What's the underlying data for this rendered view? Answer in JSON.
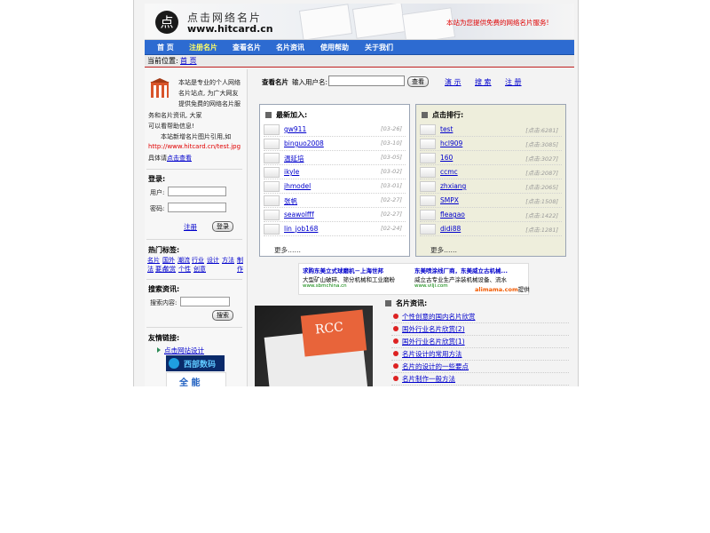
{
  "header": {
    "logo_char": "点",
    "logo_cn": "点击网络名片",
    "logo_url": "www.hitcard.cn",
    "slogan": "本站为您提供免费的网络名片服务!"
  },
  "nav": {
    "items": [
      "首 页",
      "注册名片",
      "查看名片",
      "名片资讯",
      "使用帮助",
      "关于我们"
    ]
  },
  "breadcrumb": {
    "label": "当前位置:",
    "home": "首 页"
  },
  "intro": {
    "lines": [
      "本站是专业的个人网络",
      "名片站点, 为广大网友",
      "提供免费的网络名片服",
      "务和名片资讯, 大家",
      "可以看帮助信息!",
      "本站新增名片图片引用,如"
    ],
    "example_url": "http://www.hitcard.cn/test.jpg",
    "detail_prefix": "具体请",
    "detail_link": "点击查看"
  },
  "login": {
    "title": "登录:",
    "user_label": "用户:",
    "pass_label": "密码:",
    "register": "注册",
    "login_button": "登录"
  },
  "tags": {
    "title": "热门标签:",
    "items": [
      "名片",
      "国外",
      "潮流",
      "行业",
      "设计",
      "方法",
      "制作",
      "法",
      "要点",
      "欣赏",
      "个性",
      "创意"
    ]
  },
  "search_info": {
    "title": "搜索资讯:",
    "label": "搜索内容:",
    "button": "搜索"
  },
  "friends": {
    "title": "友情链接:",
    "link": "点击网站设计",
    "banner1": "西部数码",
    "banner2": "全 能"
  },
  "topsearch": {
    "label1": "查看名片",
    "label2": "输入用户名:",
    "button": "查看",
    "links": [
      "演 示",
      "搜 索",
      "注 册"
    ]
  },
  "latest": {
    "title": "最新加入:",
    "items": [
      {
        "name": "gw911",
        "date": "[03-26]"
      },
      {
        "name": "binguo2008",
        "date": "[03-10]"
      },
      {
        "name": "温延培",
        "date": "[03-05]"
      },
      {
        "name": "ikyle",
        "date": "[03-02]"
      },
      {
        "name": "jhmodel",
        "date": "[03-01]"
      },
      {
        "name": "张帆",
        "date": "[02-27]"
      },
      {
        "name": "seawolfff",
        "date": "[02-27]"
      },
      {
        "name": "lin_job168",
        "date": "[02-24]"
      }
    ],
    "more": "更多……"
  },
  "ranking": {
    "title": "点击排行:",
    "items": [
      {
        "name": "test",
        "clicks": "[点击:6281]"
      },
      {
        "name": "hcl909",
        "clicks": "[点击:3085]"
      },
      {
        "name": "160",
        "clicks": "[点击:3027]"
      },
      {
        "name": "ccmc",
        "clicks": "[点击:2087]"
      },
      {
        "name": "zhxiang",
        "clicks": "[点击:2065]"
      },
      {
        "name": "SMPX",
        "clicks": "[点击:1508]"
      },
      {
        "name": "fleagao",
        "clicks": "[点击:1422]"
      },
      {
        "name": "didi88",
        "clicks": "[点击:1281]"
      }
    ],
    "more": "更多……"
  },
  "ad": {
    "l1": "求购东美立式球磨机－上海世邦",
    "l2": "大型矿山破碎、筛分机械和工业磨粉",
    "l3": "www.sbmchina.cn",
    "r1": "东美喷涂线厂商，东美威立古机械...",
    "r2": "威立古专业生产涂装机械设备、流水",
    "r3": "www.vilji.com",
    "brand": "alimama.com",
    "brand_suffix": "提供"
  },
  "photo": {
    "text": "RCC"
  },
  "news": {
    "title": "名片资讯:",
    "items": [
      "个性创意的国内名片欣赏",
      "国外行业名片欣赏(2)",
      "国外行业名片欣赏(1)",
      "名片设计的常用方法",
      "名片的设计的一些要点",
      "名片制作一般方法"
    ]
  },
  "colors": {
    "nav": "#2d6bd1",
    "accent_red": "#e00000",
    "link": "#0000cc"
  }
}
